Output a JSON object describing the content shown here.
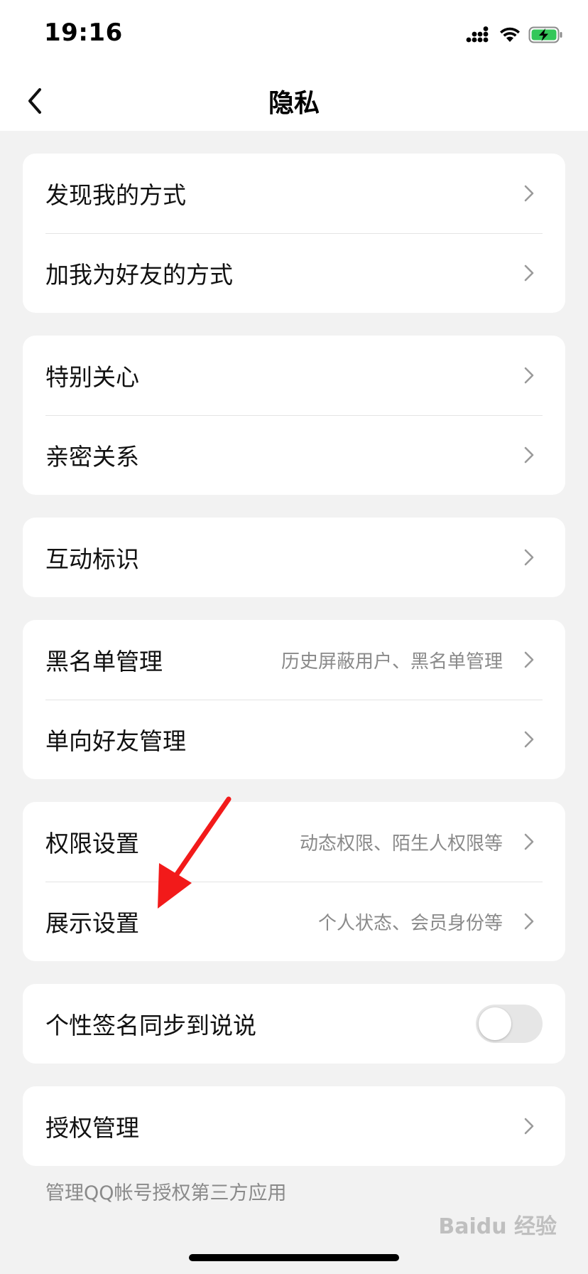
{
  "status_bar": {
    "time": "19:16",
    "icons": [
      "cellular-signal-icon",
      "wifi-icon",
      "battery-charging-icon"
    ],
    "battery_color": "#34c759"
  },
  "nav": {
    "title": "隐私",
    "back_icon": "chevron-left-icon"
  },
  "groups": [
    {
      "rows": [
        {
          "label": "发现我的方式",
          "detail": "",
          "control": "chevron"
        },
        {
          "label": "加我为好友的方式",
          "detail": "",
          "control": "chevron"
        }
      ]
    },
    {
      "rows": [
        {
          "label": "特别关心",
          "detail": "",
          "control": "chevron"
        },
        {
          "label": "亲密关系",
          "detail": "",
          "control": "chevron"
        }
      ]
    },
    {
      "rows": [
        {
          "label": "互动标识",
          "detail": "",
          "control": "chevron"
        }
      ]
    },
    {
      "rows": [
        {
          "label": "黑名单管理",
          "detail": "历史屏蔽用户、黑名单管理",
          "control": "chevron"
        },
        {
          "label": "单向好友管理",
          "detail": "",
          "control": "chevron"
        }
      ]
    },
    {
      "rows": [
        {
          "label": "权限设置",
          "detail": "动态权限、陌生人权限等",
          "control": "chevron"
        },
        {
          "label": "展示设置",
          "detail": "个人状态、会员身份等",
          "control": "chevron"
        }
      ]
    },
    {
      "rows": [
        {
          "label": "个性签名同步到说说",
          "detail": "",
          "control": "toggle",
          "toggle_on": false
        }
      ]
    },
    {
      "rows": [
        {
          "label": "授权管理",
          "detail": "",
          "control": "chevron"
        }
      ]
    }
  ],
  "footnote": "管理QQ帐号授权第三方应用",
  "annotation": {
    "type": "arrow",
    "color": "#f21a1a",
    "points_to": "展示设置"
  },
  "watermark": "Baidu 经验"
}
